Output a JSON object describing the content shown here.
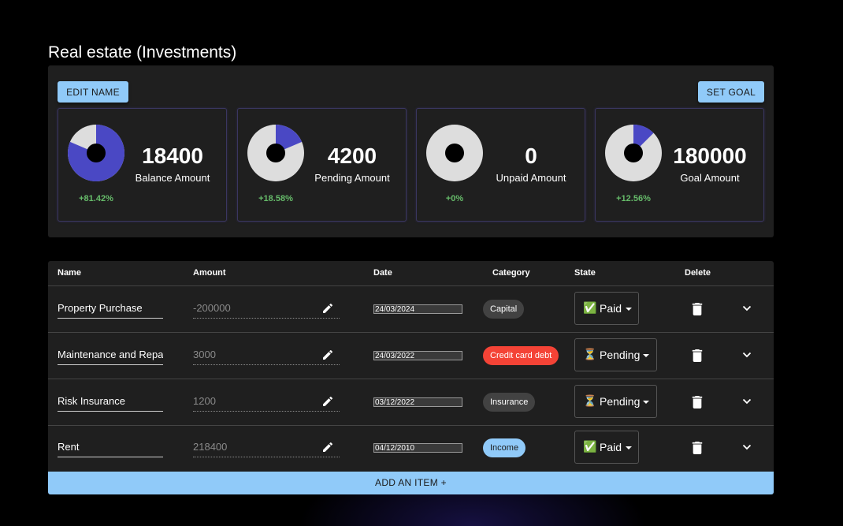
{
  "page_title": "Real estate (Investments)",
  "summary": {
    "edit_name_label": "EDIT NAME",
    "set_goal_label": "SET GOAL",
    "cards": [
      {
        "value": "18400",
        "label": "Balance Amount",
        "pct": "+81.42%",
        "fraction": 0.8142
      },
      {
        "value": "4200",
        "label": "Pending Amount",
        "pct": "+18.58%",
        "fraction": 0.1858
      },
      {
        "value": "0",
        "label": "Unpaid Amount",
        "pct": "+0%",
        "fraction": 0
      },
      {
        "value": "180000",
        "label": "Goal Amount",
        "pct": "+12.56%",
        "fraction": 0.1256
      }
    ]
  },
  "colors": {
    "accent": "#90caf9",
    "donut_fill": "#4a48c4",
    "donut_rest": "#dddddd",
    "pct_green": "#66bb6a"
  },
  "table": {
    "headers": {
      "name": "Name",
      "amount": "Amount",
      "date": "Date",
      "category": "Category",
      "state": "State",
      "delete": "Delete"
    },
    "rows": [
      {
        "name": "Property Purchase",
        "amount": "-200000",
        "date": "24/03/2024",
        "category": "Capital",
        "category_color": "#424242",
        "category_text_color": "#ffffff",
        "state_emoji": "✅",
        "state": "Paid"
      },
      {
        "name": "Maintenance and Repairs",
        "amount": "3000",
        "date": "24/03/2022",
        "category": "Credit card debt",
        "category_color": "#f44336",
        "category_text_color": "#ffffff",
        "state_emoji": "⏳",
        "state": "Pending"
      },
      {
        "name": "Risk Insurance",
        "amount": "1200",
        "date": "03/12/2022",
        "category": "Insurance",
        "category_color": "#424242",
        "category_text_color": "#ffffff",
        "state_emoji": "⏳",
        "state": "Pending"
      },
      {
        "name": "Rent",
        "amount": "218400",
        "date": "04/12/2010",
        "category": "Income",
        "category_color": "#90caf9",
        "category_text_color": "#1b1b1b",
        "state_emoji": "✅",
        "state": "Paid"
      }
    ],
    "add_item_label": "ADD AN ITEM +"
  }
}
